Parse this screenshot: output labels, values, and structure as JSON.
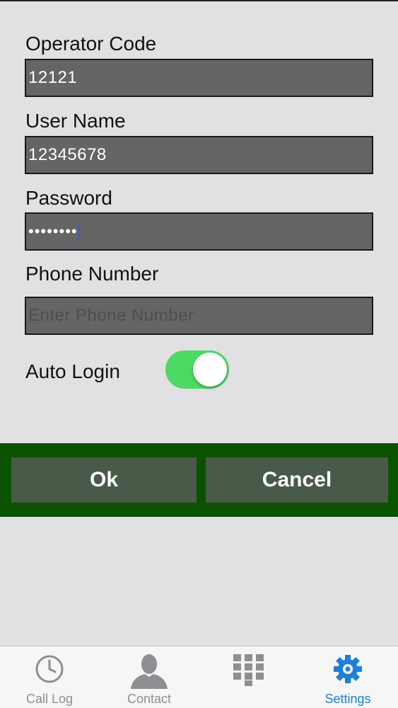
{
  "form": {
    "operator_code": {
      "label": "Operator Code",
      "value": "12121"
    },
    "user_name": {
      "label": "User Name",
      "value": "12345678"
    },
    "password": {
      "label": "Password",
      "value": "••••••••"
    },
    "phone_number": {
      "label": "Phone Number",
      "value": "",
      "placeholder": "Enter Phone Number"
    },
    "auto_login": {
      "label": "Auto Login",
      "enabled": true
    }
  },
  "actions": {
    "ok_label": "Ok",
    "cancel_label": "Cancel"
  },
  "tabs": [
    {
      "label": "Call Log",
      "icon": "clock-icon",
      "active": false
    },
    {
      "label": "Contact",
      "icon": "person-icon",
      "active": false
    },
    {
      "label": "",
      "icon": "keypad-icon",
      "active": false
    },
    {
      "label": "Settings",
      "icon": "gear-icon",
      "active": true
    }
  ],
  "colors": {
    "background": "#e1e0e2",
    "input_fill": "#656466",
    "toggle_on": "#4cd964",
    "button_bar": "#0a5200",
    "button_fill": "#495a48",
    "tab_active": "#1e7fd6",
    "tab_inactive": "#8e8e93"
  }
}
